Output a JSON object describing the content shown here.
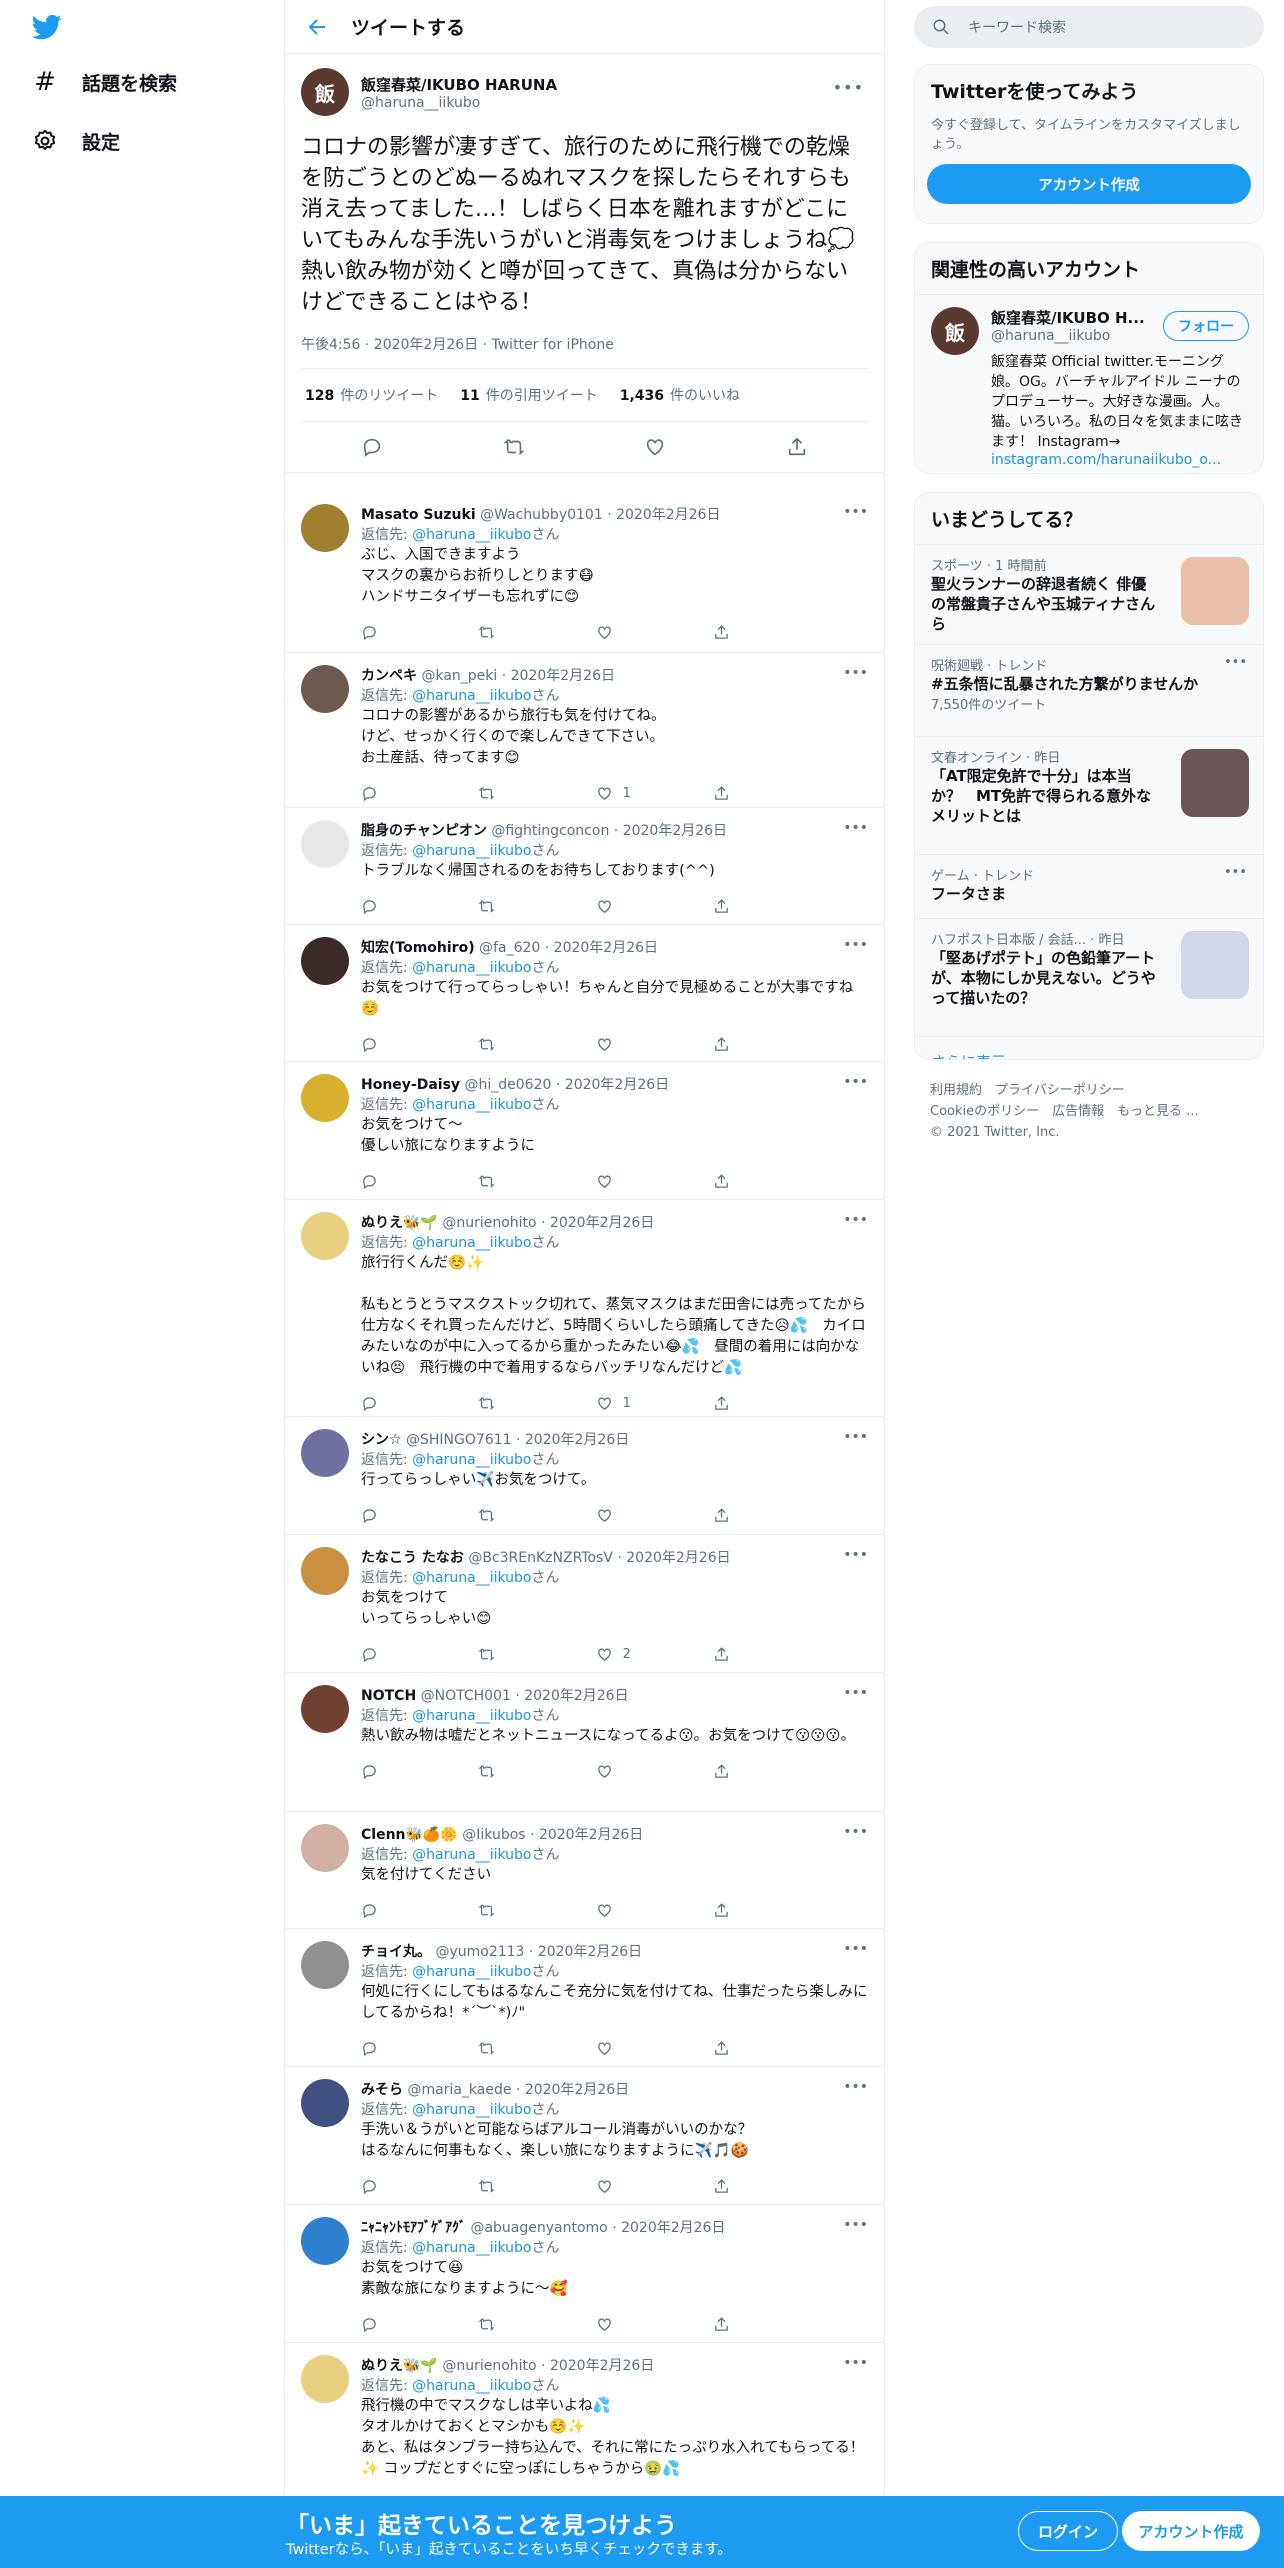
{
  "nav": {
    "explore": "話題を検索",
    "settings": "設定"
  },
  "header": {
    "title": "ツイートする"
  },
  "tweet": {
    "name": "飯窪春菜/IKUBO HARUNA",
    "handle": "@haruna__iikubo",
    "text": "コロナの影響が凄すぎて、旅行のために飛行機での乾燥を防ごうとのどぬーるぬれマスクを探したらそれすらも消え去ってました…！しばらく日本を離れますがどこにいてもみんな手洗いうがいと消毒気をつけましょうね💭\n熱い飲み物が効くと噂が回ってきて、真偽は分からないけどできることはやる！",
    "meta": "午後4:56 · 2020年2月26日 · Twitter for iPhone",
    "retweets_n": "128",
    "retweets_l": "件のリツイート",
    "quotes_n": "11",
    "quotes_l": "件の引用ツイート",
    "likes_n": "1,436",
    "likes_l": "件のいいね"
  },
  "reply_prefix": "返信先: ",
  "reply_suffix": "さん",
  "replies": [
    {
      "name": "Masato Suzuki",
      "handle": "@Wachubby0101",
      "date": "2020年2月26日",
      "to": "@haruna__iikubo",
      "text": "ぶじ、入国できますよう\nマスクの裏からお祈りしとります😷\nハンドサニタイザーも忘れずに😊",
      "likes": "",
      "color": "#a08030"
    },
    {
      "name": "カンペキ",
      "handle": "@kan_peki",
      "date": "2020年2月26日",
      "to": "@haruna__iikubo",
      "text": "コロナの影響があるから旅行も気を付けてね。\nけど、せっかく行くので楽しんできて下さい。\nお土産話、待ってます😊",
      "likes": "1",
      "color": "#6b5a50"
    },
    {
      "name": "脂身のチャンピオン",
      "handle": "@fightingconcon",
      "date": "2020年2月26日",
      "to": "@haruna__iikubo",
      "text": "トラブルなく帰国されるのをお待ちしております(^^)",
      "likes": "",
      "color": "#e8e8e8"
    },
    {
      "name": "知宏(Tomohiro)",
      "handle": "@fa_620",
      "date": "2020年2月26日",
      "to": "@haruna__iikubo",
      "text": "お気をつけて行ってらっしゃい！ちゃんと自分で見極めることが大事ですね☺️",
      "likes": "",
      "color": "#3a2a28"
    },
    {
      "name": "Honey-Daisy",
      "handle": "@hi_de0620",
      "date": "2020年2月26日",
      "to": "@haruna__iikubo",
      "text": "お気をつけて〜\n優しい旅になりますように",
      "likes": "",
      "color": "#d8b030"
    },
    {
      "name": "ぬりえ🐝🌱",
      "handle": "@nurienohito",
      "date": "2020年2月26日",
      "to": "@haruna__iikubo",
      "text": "旅行行くんだ☺️✨\n\n私もとうとうマスクストック切れて、蒸気マスクはまだ田舎には売ってたから仕方なくそれ買ったんだけど、5時間くらいしたら頭痛してきた😥💦　カイロみたいなのが中に入ってるから重かったみたい😂💦　昼間の着用には向かないね😣　飛行機の中で着用するならバッチリなんだけど💦",
      "likes": "1",
      "color": "#e8d080"
    },
    {
      "name": "シン☆",
      "handle": "@SHINGO7611",
      "date": "2020年2月26日",
      "to": "@haruna__iikubo",
      "text": "行ってらっしゃい✈️お気をつけて。",
      "likes": "",
      "color": "#7070a0"
    },
    {
      "name": "たなこう たなお",
      "handle": "@Bc3REnKzNZRTosV",
      "date": "2020年2月26日",
      "to": "@haruna__iikubo",
      "text": "お気をつけて\nいってらっしゃい😊",
      "likes": "2",
      "color": "#c89040"
    },
    {
      "name": "NOTCH",
      "handle": "@NOTCH001",
      "date": "2020年2月26日",
      "to": "@haruna__iikubo",
      "text": "熱い飲み物は嘘だとネットニュースになってるよ😗。お気をつけて😗😗😗。",
      "likes": "",
      "color": "#704030"
    },
    {
      "name": "Clenn🐝🍊🌼",
      "handle": "@Iikubos",
      "date": "2020年2月26日",
      "to": "@haruna__iikubo",
      "text": "気を付けてください",
      "likes": "",
      "color": "#d0b0a0"
    },
    {
      "name": "チョイ丸。",
      "handle": "@yumo2113",
      "date": "2020年2月26日",
      "to": "@haruna__iikubo",
      "text": "何処に行くにしてもはるなんこそ充分に気を付けてね、仕事だったら楽しみにしてるからね！*´︶`*)ﾉ\"",
      "likes": "",
      "color": "#909090"
    },
    {
      "name": "みそら",
      "handle": "@maria_kaede",
      "date": "2020年2月26日",
      "to": "@haruna__iikubo",
      "text": "手洗い＆うがいと可能ならばアルコール消毒がいいのかな？\nはるなんに何事もなく、楽しい旅になりますように✈️🎵🍪",
      "likes": "",
      "color": "#405080"
    },
    {
      "name": "ﾆｬﾆｬﾝﾄﾓｱﾌﾞｹﾞｱｸﾞ",
      "handle": "@abuagenyantomo",
      "date": "2020年2月26日",
      "to": "@haruna__iikubo",
      "text": "お気をつけて😆\n素敵な旅になりますように〜🥰",
      "likes": "",
      "color": "#3080d0"
    },
    {
      "name": "ぬりえ🐝🌱",
      "handle": "@nurienohito",
      "date": "2020年2月26日",
      "to": "@haruna__iikubo",
      "text": "飛行機の中でマスクなしは辛いよね💦\nタオルかけておくとマシかも☺️✨\nあと、私はタンブラー持ち込んで、それに常にたっぷり水入れてもらってる！✨ コップだとすぐに空っぽにしちゃうから🤢💦",
      "likes": "",
      "color": "#e8d080"
    }
  ],
  "right": {
    "search_placeholder": "キーワード検索",
    "signup_title": "Twitterを使ってみよう",
    "signup_text": "今すぐ登録して、タイムラインをカスタマイズしましょう。",
    "signup_btn": "アカウント作成",
    "related_title": "関連性の高いアカウント",
    "related_name": "飯窪春菜/IKUBO H...",
    "related_handle": "@haruna__iikubo",
    "follow": "フォロー",
    "related_bio": "飯窪春菜 Official twitter.モーニング娘。OG。バーチャルアイドル ニーナのプロデューサー。大好きな漫画。人。猫。いろいろ。私の日々を気ままに呟きます！ Instagram→",
    "related_link": "instagram.com/harunaiikubo_o...",
    "trends_title": "いまどうしてる？",
    "trends": [
      {
        "cat": "スポーツ · 1 時間前",
        "title": "聖火ランナーの辞退者続く 俳優の常盤貴子さんや玉城ティナさんら",
        "count": ""
      },
      {
        "cat": "呪術廻戦 · トレンド",
        "title": "#五条悟に乱暴された方繋がりませんか",
        "count": "7,550件のツイート"
      },
      {
        "cat": "文春オンライン · 昨日",
        "title": "「AT限定免許で十分」は本当か？　MT免許で得られる意外なメリットとは",
        "count": ""
      },
      {
        "cat": "ゲーム · トレンド",
        "title": "フータさま",
        "count": ""
      },
      {
        "cat": "ハフポスト日本版 / 会話... · 昨日",
        "title": "「堅あげポテト」の色鉛筆アートが、本物にしか見えない。どうやって描いたの？",
        "count": ""
      }
    ],
    "show_more": "さらに表示",
    "footer1": "利用規約　プライバシーポリシー",
    "footer2": "Cookieのポリシー　広告情報　もっと見る ...",
    "footer3": "© 2021 Twitter, Inc."
  },
  "bottom": {
    "title": "「いま」起きていることを見つけよう",
    "text": "Twitterなら、「いま」起きていることをいち早くチェックできます。",
    "login": "ログイン",
    "signup": "アカウント作成"
  }
}
